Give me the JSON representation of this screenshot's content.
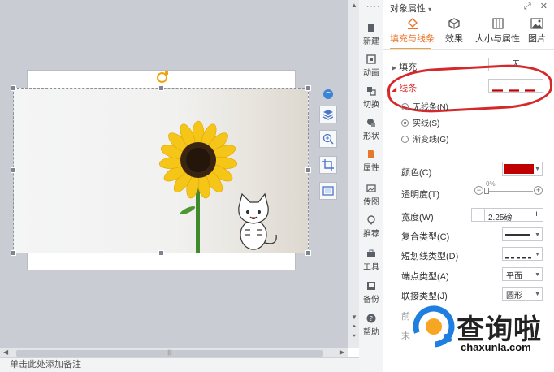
{
  "canvas": {
    "note_placeholder": "单击此处添加备注"
  },
  "sidebar": {
    "items": [
      {
        "label": "新建",
        "icon": "new-file-icon"
      },
      {
        "label": "动画",
        "icon": "animation-icon"
      },
      {
        "label": "切换",
        "icon": "transition-icon"
      },
      {
        "label": "形状",
        "icon": "shape-icon"
      },
      {
        "label": "属性",
        "icon": "properties-icon"
      },
      {
        "label": "传图",
        "icon": "upload-image-icon"
      },
      {
        "label": "推荐",
        "icon": "recommend-icon"
      },
      {
        "label": "工具",
        "icon": "toolbox-icon"
      },
      {
        "label": "备份",
        "icon": "backup-icon"
      },
      {
        "label": "帮助",
        "icon": "help-icon"
      }
    ]
  },
  "panel": {
    "title": "对象属性",
    "tabs": [
      {
        "label": "填充与线条",
        "icon": "fill-bucket-icon"
      },
      {
        "label": "效果",
        "icon": "effect-cube-icon"
      },
      {
        "label": "大小与属性",
        "icon": "size-grid-icon"
      },
      {
        "label": "图片",
        "icon": "picture-icon"
      }
    ],
    "fill": {
      "label": "填充",
      "value": "无"
    },
    "line": {
      "label": "线条",
      "options": [
        "无线条(N)",
        "实线(S)",
        "渐变线(G)"
      ],
      "selected": "实线(S)"
    },
    "props": {
      "color_label": "颜色(C)",
      "color_value": "#c00000",
      "transparency_label": "透明度(T)",
      "transparency_value": "0%",
      "width_label": "宽度(W)",
      "width_value": "2.25磅",
      "compound_label": "复合类型(C)",
      "dash_label": "短划线类型(D)",
      "cap_label": "端点类型(A)",
      "cap_value": "平面",
      "join_label": "联接类型(J)",
      "join_value": "圆形",
      "front_label": "前",
      "end_label": "末"
    }
  },
  "watermark": {
    "text": "查询啦",
    "url": "chaxunla.com"
  },
  "accent": "#e8a33a"
}
